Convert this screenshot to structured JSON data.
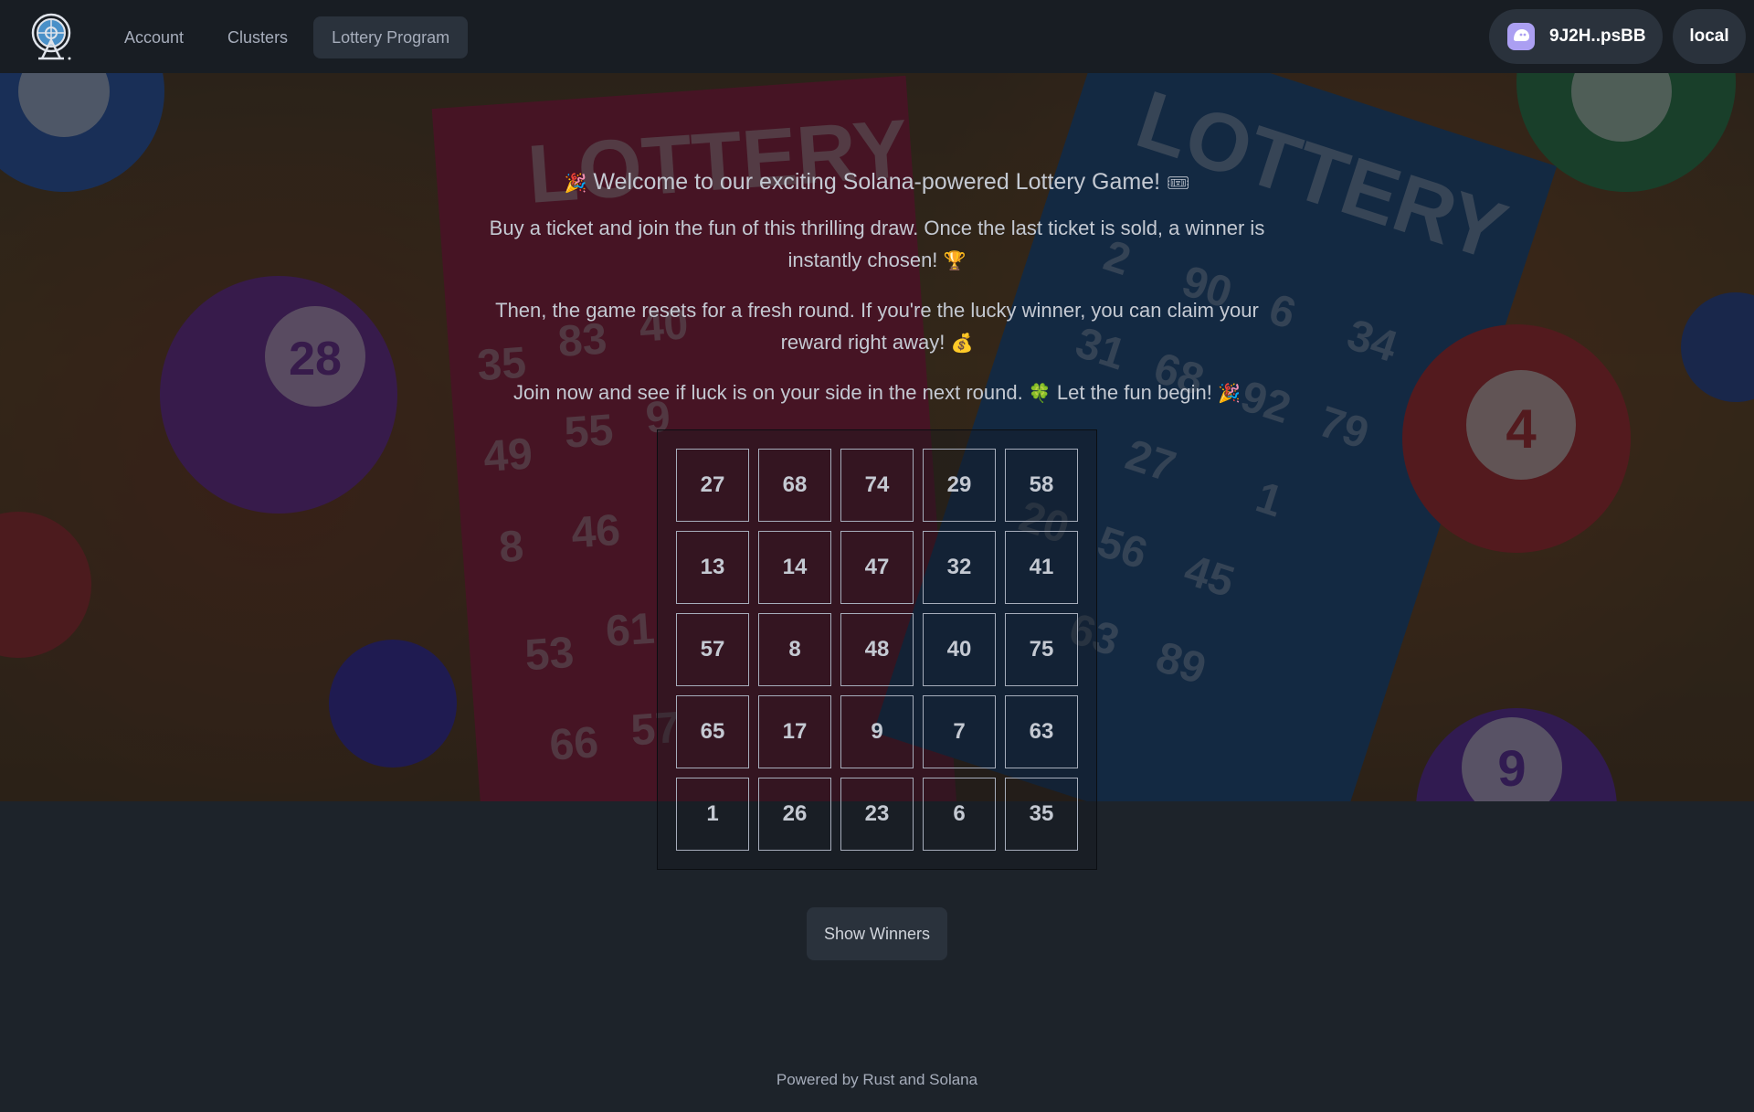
{
  "nav": {
    "links": [
      {
        "label": "Account"
      },
      {
        "label": "Clusters"
      },
      {
        "label": "Lottery Program"
      }
    ],
    "wallet_label": "9J2H..psBB",
    "cluster_label": "local"
  },
  "hero": {
    "title": "Welcome to our exciting Solana-powered Lottery Game!",
    "title_emoji_start": "🎉",
    "title_emoji_end": "🎟",
    "paragraph1": "Buy a ticket and join the fun of this thrilling draw. Once the last ticket is sold, a winner is instantly chosen!",
    "paragraph1_emoji": "🏆",
    "paragraph2": "Then, the game resets for a fresh round. If you're the lucky winner, you can claim your reward right away!",
    "paragraph2_emoji": "💰",
    "paragraph3_a": "Join now and see if luck is on your side in the next round.",
    "paragraph3_emoji1": "🍀",
    "paragraph3_b": "Let the fun begin!",
    "paragraph3_emoji2": "🎉"
  },
  "board": {
    "numbers": [
      [
        27,
        68,
        74,
        29,
        58
      ],
      [
        13,
        14,
        47,
        32,
        41
      ],
      [
        57,
        8,
        48,
        40,
        75
      ],
      [
        65,
        17,
        9,
        7,
        63
      ],
      [
        1,
        26,
        23,
        6,
        35
      ]
    ]
  },
  "actions": {
    "show_winners_label": "Show Winners"
  },
  "footer": {
    "text": "Powered by Rust and Solana"
  },
  "colors": {
    "background": "#1d232a",
    "navbar": "#181d23",
    "button": "#2a323c",
    "wallet_accent": "#ab9ff2",
    "text": "#a6adbb"
  }
}
